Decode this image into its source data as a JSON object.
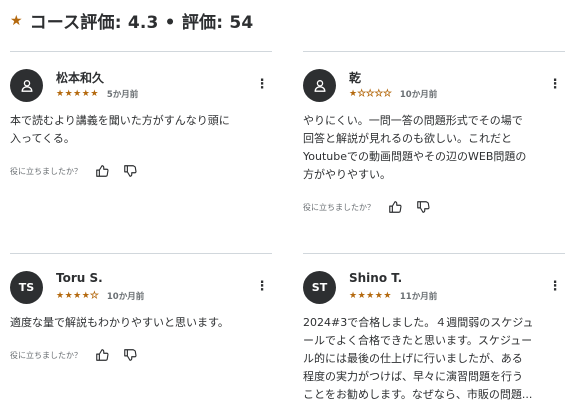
{
  "header": {
    "title": "コース評価: 4.3 • 評価: 54"
  },
  "helpful_prompt": "役に立ちましたか？",
  "reviews": [
    {
      "name": "松本和久",
      "avatar_text": "",
      "avatar_icon": "user-icon",
      "stars": 5,
      "date": "5か月前",
      "lines": [
        "本で読むより講義を聞いた方がすんなり頭に",
        "入ってくる。"
      ]
    },
    {
      "name": "乾",
      "avatar_text": "",
      "avatar_icon": "user-icon",
      "stars": 1,
      "date": "10か月前",
      "lines": [
        "やりにくい。一問一答の問題形式でその場で",
        "回答と解説が見れるのも欲しい。これだと",
        "Youtubeでの動画問題やその辺のWEB問題の",
        "方がやりやすい。"
      ]
    },
    {
      "name": "Toru S.",
      "avatar_text": "TS",
      "stars": 4,
      "date": "10か月前",
      "lines": [
        "適度な量で解説もわかりやすいと思います。"
      ]
    },
    {
      "name": "Shino T.",
      "avatar_text": "ST",
      "stars": 5,
      "date": "11か月前",
      "lines": [
        "2024#3で合格しました。４週間弱のスケジュ",
        "ールでよく合格できたと思います。スケジュー",
        "ル的には最後の仕上げに行いましたが、ある",
        "程度の実力がつけば、早々に演習問題を行う",
        "ことをお勧めします。なぜなら、市販の問題..."
      ]
    }
  ],
  "colors": {
    "star": "#b4690e",
    "text": "#2d2f31",
    "muted": "#6a6f73",
    "divider": "#d1d7dc",
    "avatar_bg": "#2d2f31"
  }
}
